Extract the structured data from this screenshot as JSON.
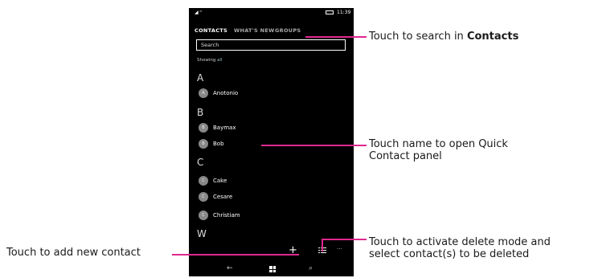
{
  "phone": {
    "status": {
      "time": "11:39",
      "signal": "signal-icon"
    },
    "tabs": [
      "CONTACTS",
      "WHAT'S NEW",
      "GROUPS"
    ],
    "search_placeholder": "Search",
    "showing_label": "Showing",
    "showing_value": "all",
    "sections": [
      {
        "letter": "A",
        "contacts": [
          {
            "initial": "A",
            "name": "Anotonio"
          }
        ]
      },
      {
        "letter": "B",
        "contacts": [
          {
            "initial": "B",
            "name": "Baymax"
          },
          {
            "initial": "B",
            "name": "Bob"
          }
        ]
      },
      {
        "letter": "C",
        "contacts": [
          {
            "initial": "C",
            "name": "Cake"
          },
          {
            "initial": "C",
            "name": "Cesare"
          },
          {
            "initial": "C",
            "name": "Christiam"
          }
        ]
      },
      {
        "letter": "W",
        "contacts": []
      }
    ],
    "appbar": {
      "add_icon": "+",
      "more_icon": "..."
    },
    "nav": {
      "back_icon": "←",
      "search_icon": "⌕"
    }
  },
  "callouts": {
    "search_prefix": "Touch to search in ",
    "search_bold": "Contacts",
    "quick_line1": "Touch name to open Quick",
    "quick_line2": "Contact panel",
    "add": "Touch to add new contact",
    "delete_line1": "Touch to activate delete mode and",
    "delete_line2": "select contact(s) to be deleted"
  },
  "colors": {
    "accent_line": "#e0288e",
    "phone_bg": "#000000",
    "avatar": "#888888"
  }
}
